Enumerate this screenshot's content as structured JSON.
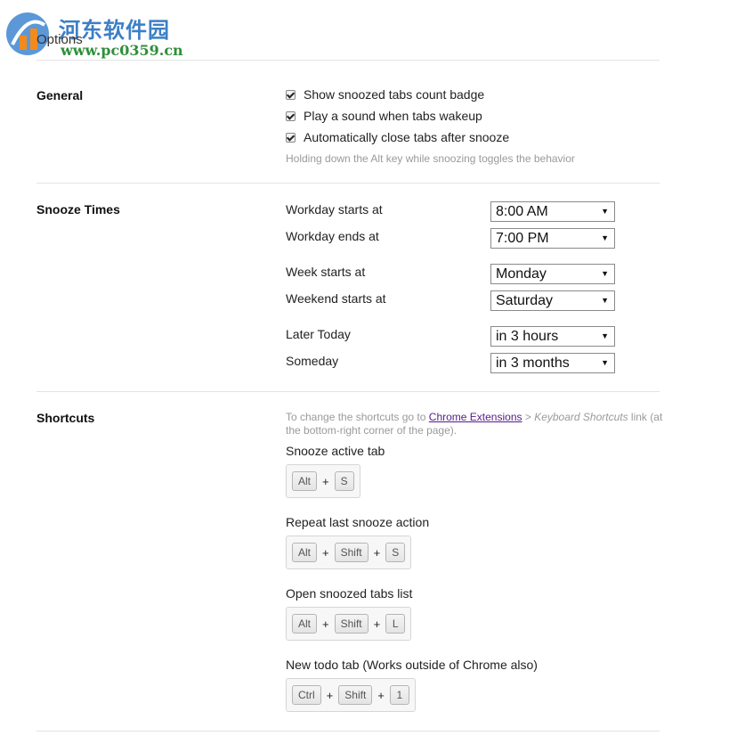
{
  "watermark": {
    "cn": "河东软件园",
    "url": "www.pc0359.cn"
  },
  "page": {
    "title": "Options"
  },
  "general": {
    "title": "General",
    "options": [
      {
        "label": "Show snoozed tabs count badge",
        "checked": true
      },
      {
        "label": "Play a sound when tabs wakeup",
        "checked": true
      },
      {
        "label": "Automatically close tabs after snooze",
        "checked": true
      }
    ],
    "hint": "Holding down the Alt key while snoozing toggles the behavior"
  },
  "snooze_times": {
    "title": "Snooze Times",
    "fields": [
      {
        "label": "Workday starts at",
        "value": "8:00 AM"
      },
      {
        "label": "Workday ends at",
        "value": "7:00 PM"
      },
      {
        "label": "Week starts at",
        "value": "Monday"
      },
      {
        "label": "Weekend starts at",
        "value": "Saturday"
      },
      {
        "label": "Later Today",
        "value": "in 3 hours"
      },
      {
        "label": "Someday",
        "value": "in 3 months"
      }
    ],
    "arrow": "▼"
  },
  "shortcuts": {
    "title": "Shortcuts",
    "hint_pre": "To change the shortcuts go to ",
    "hint_link": "Chrome Extensions",
    "hint_mid": " > ",
    "hint_italic": "Keyboard Shortcuts",
    "hint_post": " link (at the bottom-right corner of the page).",
    "plus": "+",
    "items": [
      {
        "label": "Snooze active tab",
        "keys": [
          "Alt",
          "S"
        ]
      },
      {
        "label": "Repeat last snooze action",
        "keys": [
          "Alt",
          "Shift",
          "S"
        ]
      },
      {
        "label": "Open snoozed tabs list",
        "keys": [
          "Alt",
          "Shift",
          "L"
        ]
      },
      {
        "label": "New todo tab (Works outside of Chrome also)",
        "keys": [
          "Ctrl",
          "Shift",
          "1"
        ]
      }
    ]
  }
}
